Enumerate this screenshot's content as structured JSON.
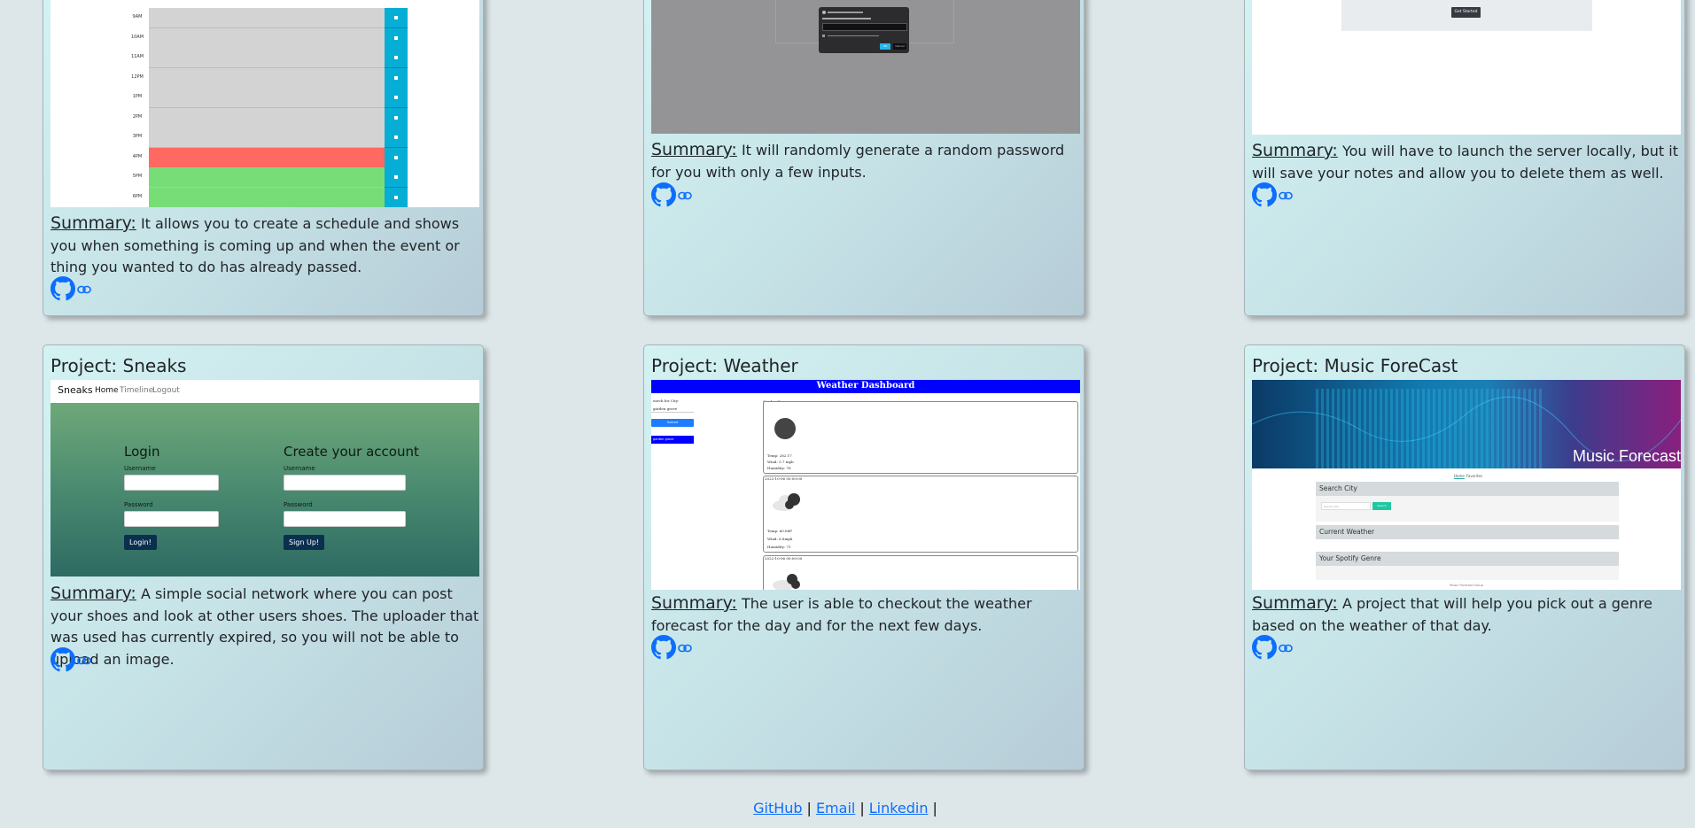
{
  "projects": [
    {
      "summary_label": "Summary:",
      "summary": "It allows you to create a schedule and shows you when something is coming up and when the event or thing you wanted to do has already passed.",
      "icons": [
        "github-icon",
        "link-icon"
      ],
      "screenshot": {
        "rows": [
          {
            "time": "9AM",
            "state": "past"
          },
          {
            "time": "10AM",
            "state": "past"
          },
          {
            "time": "11AM",
            "state": "past"
          },
          {
            "time": "12PM",
            "state": "past"
          },
          {
            "time": "1PM",
            "state": "past"
          },
          {
            "time": "2PM",
            "state": "past"
          },
          {
            "time": "3PM",
            "state": "past"
          },
          {
            "time": "4PM",
            "state": "present"
          },
          {
            "time": "5PM",
            "state": "future"
          },
          {
            "time": "6PM",
            "state": "future"
          }
        ],
        "colors": {
          "past": "#d3d3d3",
          "present": "#ff6961",
          "future": "#77dd77",
          "save": "#06aed5"
        }
      }
    },
    {
      "summary_label": "Summary:",
      "summary": "It will randomly generate a random password for you with only a few inputs.",
      "icons": [
        "github-icon",
        "link-icon"
      ],
      "screenshot": {
        "dialog_ok": "OK",
        "dialog_cancel": "Cancel"
      }
    },
    {
      "summary_label": "Summary:",
      "summary": "You will have to launch the server locally, but it will save your notes and allow you to delete them as well.",
      "icons": [
        "github-icon",
        "link-icon"
      ],
      "screenshot": {
        "button": "Get Started"
      }
    },
    {
      "title": "Project: Sneaks",
      "summary_label": "Summary:",
      "summary": "A simple social network where you can post your shoes and look at other users shoes. The uploader that was used has currently expired, so you will not be able to upload an image.",
      "icons": [
        "github-icon",
        "link-icon"
      ],
      "screenshot": {
        "brand": "Sneaks",
        "nav": [
          "Home",
          "Timeline",
          "Logout"
        ],
        "login_heading": "Login",
        "signup_heading": "Create your account",
        "username_label": "Username",
        "password_label": "Password",
        "login_button": "Login!",
        "signup_button": "Sign Up!"
      }
    },
    {
      "title": "Project: Weather",
      "summary_label": "Summary:",
      "summary": "The user is able to checkout the weather forecast for the day and for the next few days.",
      "icons": [
        "github-icon",
        "link-icon"
      ],
      "screenshot": {
        "header": "Weather Dashboard",
        "search_label": "earch for City:",
        "search_value": "garden grove",
        "search_button": "Submit",
        "history_item": "garden grove",
        "city_label": "Garden Grove",
        "today_temp": "Temp: 282.17",
        "today_wind": "Wind: 5.7 mph",
        "today_humidity": "Humidity: 78",
        "day1_date": "2022-10-06 00:00:00",
        "day1_temp": "Temp: 60.68F",
        "day1_wind": "Wind: 6.8mph",
        "day1_humidity": "Humidity: 71",
        "day2_date": "2022-10-06 00:00:00"
      }
    },
    {
      "title": "Project: Music ForeCast",
      "summary_label": "Summary:",
      "summary": "A project that will help you pick out a genre based on the weather of that day.",
      "icons": [
        "github-icon",
        "link-icon"
      ],
      "screenshot": {
        "banner_text": "Music Forecast",
        "tabs": [
          "Home",
          "Favorites"
        ],
        "search_heading": "Search City",
        "search_placeholder": "Search City",
        "search_button": "Search",
        "weather_heading": "Current Weather",
        "genre_heading": "Your Spotify Genre",
        "footer_text": "Music Forecast Group"
      }
    }
  ],
  "footer": {
    "links": [
      "GitHub",
      "Email",
      "Linkedin"
    ],
    "separator": "|"
  }
}
